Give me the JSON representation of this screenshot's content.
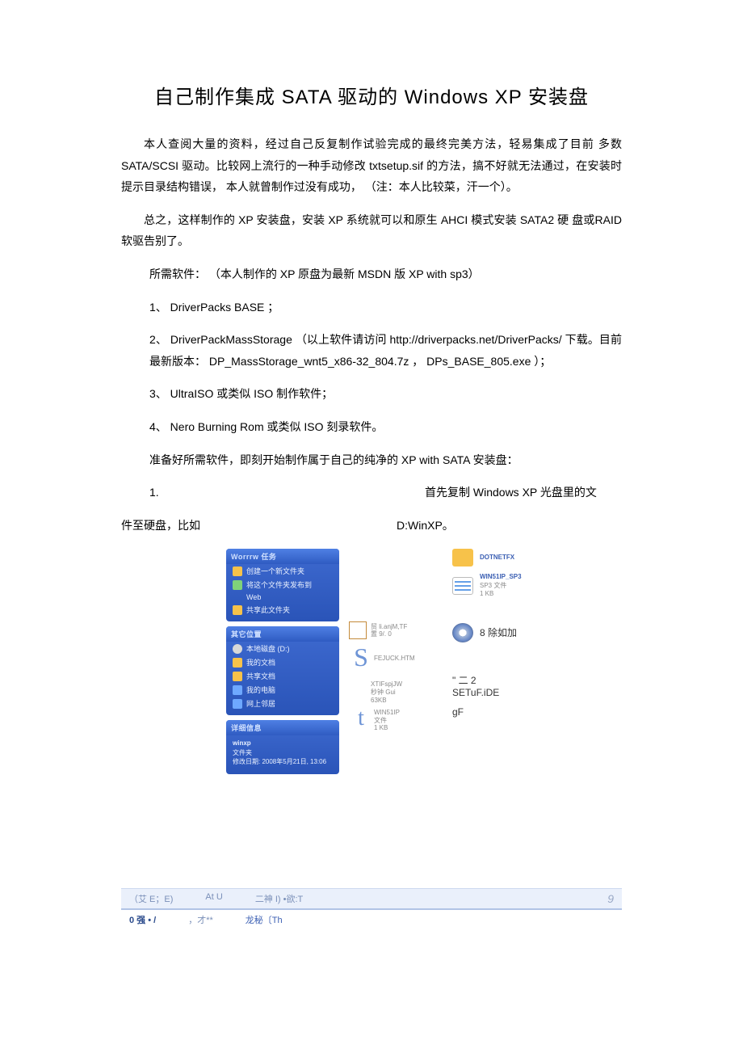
{
  "title": "自己制作集成  SATA 驱动的  Windows XP 安装盘",
  "para1": "本人查阅大量的资料，经过自己反复制作试验完成的最终完美方法，轻易集成了目前 多数SATA/SCSI 驱动。比较网上流行的一种手动修改                txtsetup.sif 的方法，搞不好就无法通过，在安装时提示目录结构错误，    本人就曾制作过没有成功，     （注：本人比较菜，汗一个）。",
  "para2": "总之，这样制作的  XP 安装盘，安装 XP 系统就可以和原生  AHCI 模式安装 SATA2 硬 盘或RAID 软驱告别了。",
  "para3": "所需软件： （本人制作的    XP 原盘为最新  MSDN 版 XP with sp3）",
  "item1": "1、 DriverPacks BASE ；",
  "item2": "2、 DriverPackMassStorage    （以上软件请访问 http://driverpacks.net/DriverPacks/        下载。目前最新版本：  DP_MassStorage_wnt5_x86-32_804.7z       ，  DPs_BASE_805.exe ）；",
  "item3": "3、 UltraISO 或类似 ISO 制作软件；",
  "item4": "4、 Nero Burning Rom 或类似 ISO 刻录软件。",
  "para4": "准备好所需软件，即刻开始制作属于自己的纯净的     XP with SATA 安装盘：",
  "step1_num": "1.",
  "step1_text": "首先复制  Windows XP 光盘里的文",
  "cont_left": "件至硬盘，比如",
  "cont_right": "D:WinXP。",
  "pane1": {
    "head": "Worrrw 任务",
    "i1": "创建一个新文件夹",
    "i2": "将这个文件夹发布到",
    "i2b": "Web",
    "i3": "共享此文件夹"
  },
  "pane2": {
    "head": "其它位置",
    "i1": "本地磁盘 (D:)",
    "i2": "我的文档",
    "i3": "共享文档",
    "i4": "我的电脑",
    "i5": "网上邻居"
  },
  "pane3": {
    "head": "详细信息",
    "name": "winxp",
    "type": "文件夹",
    "date": "修改日期: 2008年5月21日, 13:06"
  },
  "mid": {
    "m1t": "贸  li.anjM,TF",
    "m1s": "置 9/. 0",
    "m2": "FEJUCK.HTM",
    "m3t": "XTIFspjJW",
    "m3s": "秒钟 Gui",
    "m3b": "63KB",
    "m4t": "WIN51IP",
    "m4s": "文件",
    "m4b": "1 KB"
  },
  "right": {
    "r1t": "DOTNETFX",
    "r2t": "WIN51IP_SP3",
    "r2s": "SP3 文件",
    "r2b": "1 KB",
    "r3": "8 除如加",
    "r4a": "\" 二  2",
    "r4b": "SETuF.iDE",
    "r5": "gF"
  },
  "bottom": {
    "a1": "（艾 E；E)",
    "a2": "At U",
    "a3": "二神 I) •欲:T",
    "a4": "9",
    "b1": "0 强 •  /",
    "b2": "，才**",
    "b3": "龙秘〔Th"
  }
}
